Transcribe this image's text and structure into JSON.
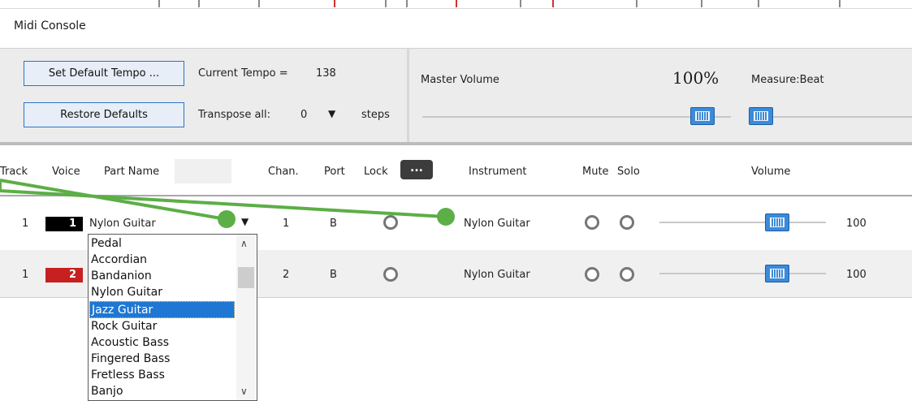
{
  "window": {
    "title": "Midi Console"
  },
  "controls": {
    "set_default_tempo_label": "Set Default Tempo ...",
    "restore_defaults_label": "Restore Defaults",
    "current_tempo_label": "Current Tempo =",
    "current_tempo_value": "138",
    "transpose_label": "Transpose all:",
    "transpose_value": "0",
    "transpose_unit": "steps",
    "master_volume_label": "Master Volume",
    "master_volume_value": "100%",
    "measure_beat_label": "Measure:Beat"
  },
  "table": {
    "headers": {
      "track": "Track",
      "voice": "Voice",
      "part_name": "Part Name",
      "chan": "Chan.",
      "port": "Port",
      "lock": "Lock",
      "ellipsis": "...",
      "instrument": "Instrument",
      "mute": "Mute",
      "solo": "Solo",
      "volume": "Volume"
    },
    "rows": [
      {
        "track": "1",
        "voice": "1",
        "voice_color": "#000000",
        "part_name": "Nylon Guitar",
        "chan": "1",
        "port": "B",
        "instrument": "Nylon Guitar",
        "volume": "100"
      },
      {
        "track": "1",
        "voice": "2",
        "voice_color": "#c62020",
        "part_name": "",
        "chan": "2",
        "port": "B",
        "instrument": "Nylon Guitar",
        "volume": "100"
      }
    ]
  },
  "dropdown": {
    "items": [
      "Pedal",
      "Accordian",
      "Bandanion",
      "Nylon Guitar",
      "Jazz Guitar",
      "Rock Guitar",
      "Acoustic Bass",
      "Fingered Bass",
      "Fretless Bass",
      "Banjo"
    ],
    "selected": "Jazz Guitar"
  },
  "colors": {
    "accent": "#2d73c6",
    "slider_thumb": "#3c8ad8",
    "annotation": "#5cae47"
  },
  "icons": {
    "dropdown_arrow": "triangle-down",
    "scroll_up": "chevron-up",
    "scroll_down": "chevron-down"
  }
}
